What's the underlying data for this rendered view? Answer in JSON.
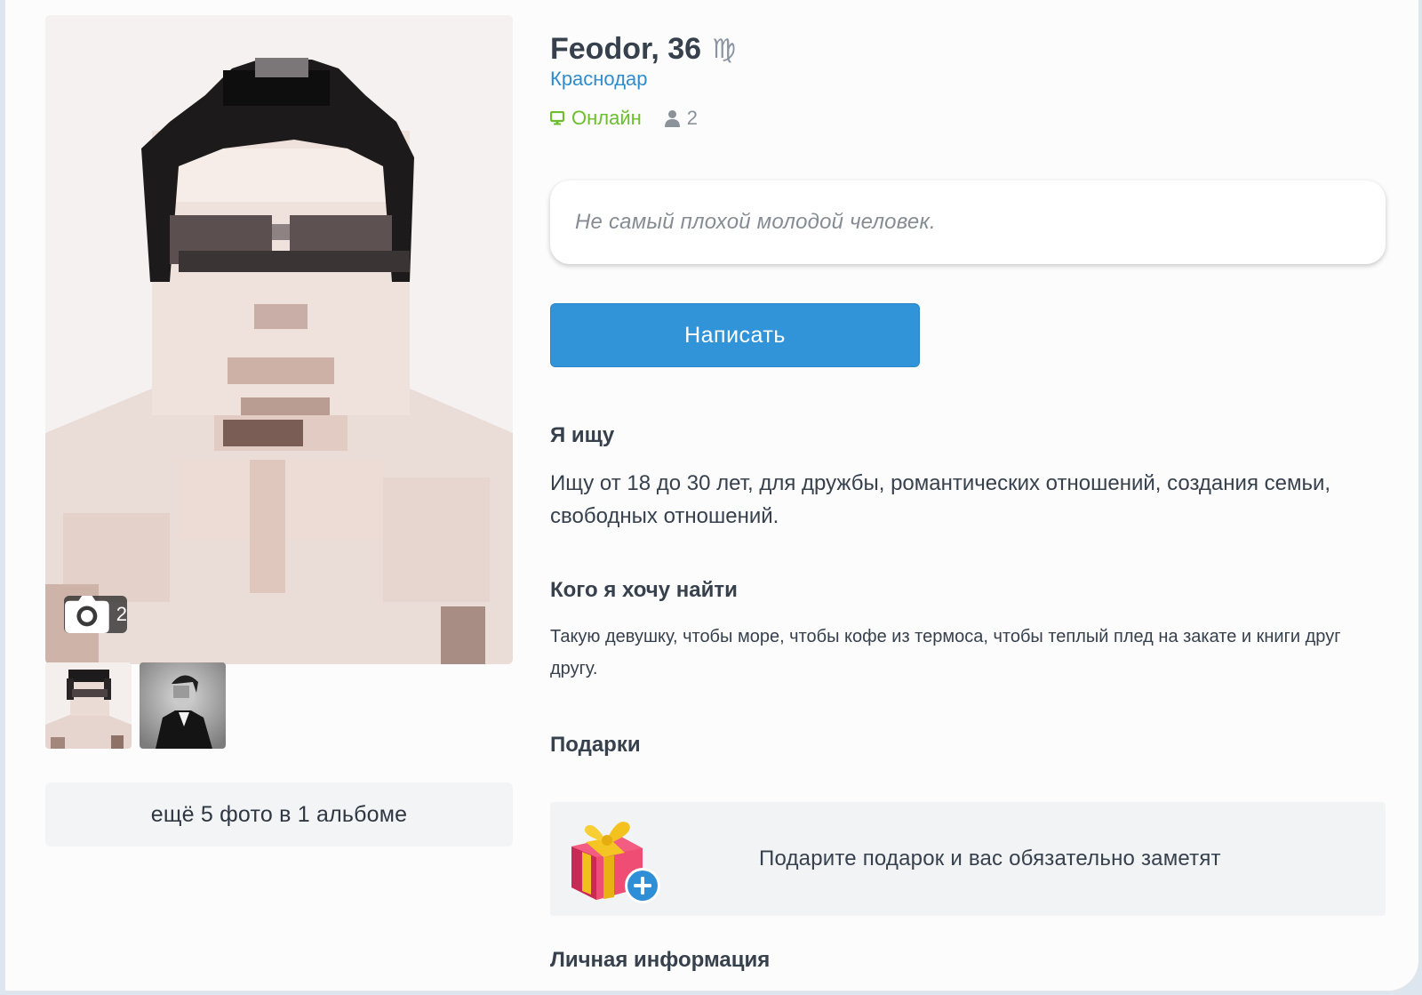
{
  "profile": {
    "name_age": "Feodor, 36",
    "zodiac_sign": "♍",
    "zodiac_icon": "virgo-icon",
    "city": "Краснодар",
    "online_status": "Онлайн",
    "visitors_count": "2",
    "status_text": "Не самый плохой молодой человек."
  },
  "photos": {
    "count": "2",
    "more_label": "ещё 5 фото в 1 альбоме",
    "thumbnails": [
      "thumbnail-1",
      "thumbnail-2"
    ]
  },
  "actions": {
    "write_label": "Написать"
  },
  "sections": {
    "looking_for_title": "Я ищу",
    "looking_for_text": "Ищу от 18 до 30 лет, для дружбы, романтических отношений, создания семьи, свободных отношений.",
    "who_title": "Кого я хочу найти",
    "who_text": "Такую девушку, чтобы море, чтобы кофе из термоса, чтобы теплый плед на закате и книги друг другу.",
    "gifts_title": "Подарки",
    "gifts_prompt": "Подарите подарок и вас обязательно заметят",
    "personal_info_title": "Личная информация"
  },
  "colors": {
    "accent": "#3294d8",
    "link": "#2f8ccd",
    "online": "#6abf2b",
    "text": "#37414e",
    "muted": "#8b929a"
  }
}
